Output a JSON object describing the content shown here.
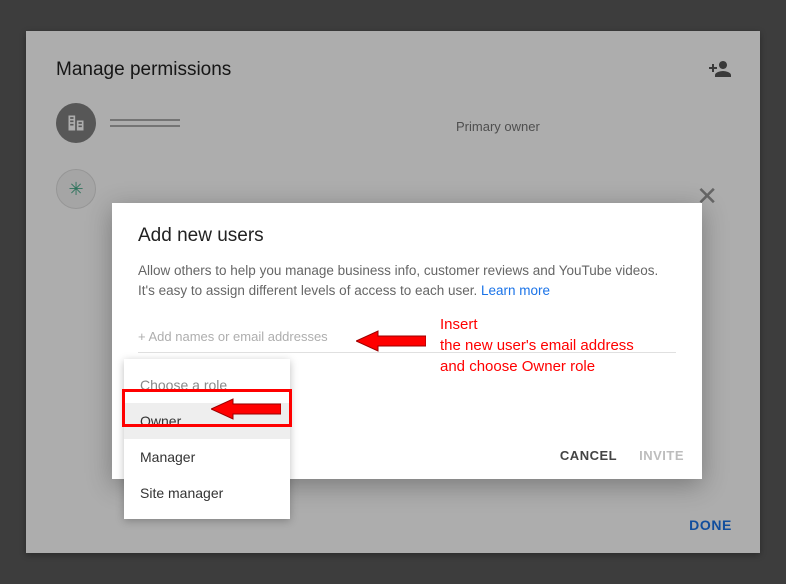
{
  "panel": {
    "title": "Manage permissions",
    "role": "Primary owner",
    "done": "DONE"
  },
  "dialog": {
    "title": "Add new users",
    "desc": "Allow others to help you manage business info, customer reviews and YouTube videos. It's easy to assign different levels of access to each user. ",
    "learn": "Learn more",
    "placeholder": "+ Add names or email addresses",
    "cancel": "CANCEL",
    "invite": "INVITE"
  },
  "dropdown": {
    "header": "Choose a role",
    "options": [
      "Owner",
      "Manager",
      "Site manager"
    ]
  },
  "annotation": {
    "line1": "Insert",
    "line2": "the new user's   email address",
    "line3": "and choose Owner role"
  },
  "colors": {
    "red": "#ff0000",
    "link": "#1a73e8"
  }
}
